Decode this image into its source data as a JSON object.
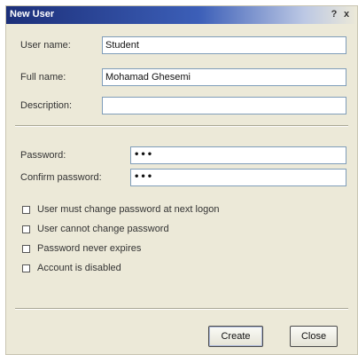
{
  "window": {
    "title": "New User",
    "help_glyph": "?",
    "close_glyph": "x"
  },
  "form": {
    "username_label": "User name:",
    "username_value": "Student",
    "fullname_label": "Full name:",
    "fullname_value": "Mohamad Ghesemi",
    "description_label": "Description:",
    "description_value": "",
    "password_label": "Password:",
    "password_value": "•••",
    "confirm_label": "Confirm password:",
    "confirm_value": "•••"
  },
  "options": [
    {
      "label": "User must change password at next logon",
      "checked": false
    },
    {
      "label": "User cannot change password",
      "checked": false
    },
    {
      "label": "Password never expires",
      "checked": false
    },
    {
      "label": "Account is disabled",
      "checked": false
    }
  ],
  "buttons": {
    "create": "Create",
    "close": "Close"
  },
  "colors": {
    "titlebar_start": "#1c2f79",
    "dialog_face": "#ece9d8",
    "field_border": "#7f9db9"
  },
  "icons": {
    "help": "question-mark-icon",
    "close": "close-x-icon"
  }
}
